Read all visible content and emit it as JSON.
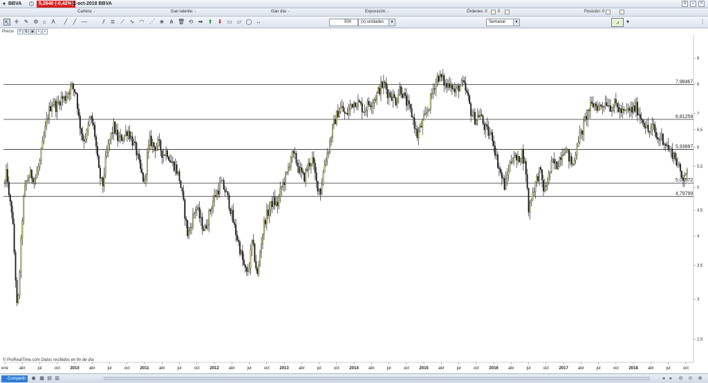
{
  "titlebar": {
    "ticker": "BBVA",
    "price_badge": "5,2640 (-0,42%)",
    "date_title": "12-oct-2018 BBVA"
  },
  "portfolio": {
    "cartera": "Cartera: -",
    "gan_latente": "Gan latente: -",
    "gan_dia": "Gan día: -",
    "exposicion": "Exposición: -",
    "ordenes": "Órdenes: 0",
    "ordenes_val": "0",
    "posicion": "Posición: 0"
  },
  "toolbar": {
    "quantity": "500",
    "units_select": "(x) unidades",
    "period_select": "Semanal"
  },
  "chart_header": {
    "label": "Precio"
  },
  "footnote": {
    "brand": "© ProRealTime.com",
    "text": "Datos recibidos en fin de día"
  },
  "statusbar": {
    "share_label": "Compartir"
  },
  "colors": {
    "candle_up": "#c8c878",
    "candle_down": "#1a1a1a",
    "line": "#2a2a2a",
    "badge": "#d82020"
  },
  "chart_data": {
    "type": "candlestick",
    "symbol": "BBVA",
    "period": "weekly",
    "scale": "log",
    "ylim": [
      2.25,
      10.0
    ],
    "y_ticks": [
      2.5,
      3,
      3.5,
      4,
      4.5,
      5,
      5.5,
      6,
      6.5,
      7,
      8,
      9
    ],
    "x_ticks": [
      {
        "label": "ene",
        "t": 2009.0
      },
      {
        "label": "abr",
        "t": 2009.25
      },
      {
        "label": "jul",
        "t": 2009.5
      },
      {
        "label": "oct",
        "t": 2009.75
      },
      {
        "label": "2010",
        "t": 2010.0
      },
      {
        "label": "abr",
        "t": 2010.25
      },
      {
        "label": "jul",
        "t": 2010.5
      },
      {
        "label": "oct",
        "t": 2010.75
      },
      {
        "label": "2011",
        "t": 2011.0
      },
      {
        "label": "abr",
        "t": 2011.25
      },
      {
        "label": "jul",
        "t": 2011.5
      },
      {
        "label": "oct",
        "t": 2011.75
      },
      {
        "label": "2012",
        "t": 2012.0
      },
      {
        "label": "abr",
        "t": 2012.25
      },
      {
        "label": "jul",
        "t": 2012.5
      },
      {
        "label": "oct",
        "t": 2012.75
      },
      {
        "label": "2013",
        "t": 2013.0
      },
      {
        "label": "abr",
        "t": 2013.25
      },
      {
        "label": "jul",
        "t": 2013.5
      },
      {
        "label": "oct",
        "t": 2013.75
      },
      {
        "label": "2014",
        "t": 2014.0
      },
      {
        "label": "abr",
        "t": 2014.25
      },
      {
        "label": "jul",
        "t": 2014.5
      },
      {
        "label": "oct",
        "t": 2014.75
      },
      {
        "label": "2015",
        "t": 2015.0
      },
      {
        "label": "abr",
        "t": 2015.25
      },
      {
        "label": "jul",
        "t": 2015.5
      },
      {
        "label": "oct",
        "t": 2015.75
      },
      {
        "label": "2016",
        "t": 2016.0
      },
      {
        "label": "abr",
        "t": 2016.25
      },
      {
        "label": "jul",
        "t": 2016.5
      },
      {
        "label": "oct",
        "t": 2016.75
      },
      {
        "label": "2017",
        "t": 2017.0
      },
      {
        "label": "abr",
        "t": 2017.25
      },
      {
        "label": "jul",
        "t": 2017.5
      },
      {
        "label": "oct",
        "t": 2017.75
      },
      {
        "label": "2018",
        "t": 2018.0
      },
      {
        "label": "abr",
        "t": 2018.25
      },
      {
        "label": "jul",
        "t": 2018.5
      },
      {
        "label": "oct",
        "t": 2018.75
      }
    ],
    "horizontal_levels": [
      {
        "value": 7.98467,
        "label": "7,98467"
      },
      {
        "value": 6.81259,
        "label": "6,81259"
      },
      {
        "value": 5.93887,
        "label": "5,93887"
      },
      {
        "value": 5.09572,
        "label": "5,09572"
      },
      {
        "value": 4.79799,
        "label": "4,79799"
      }
    ],
    "close_path": [
      [
        2009.0,
        5.1
      ],
      [
        2009.03,
        5.4
      ],
      [
        2009.06,
        4.7
      ],
      [
        2009.1,
        4.5
      ],
      [
        2009.14,
        3.6
      ],
      [
        2009.18,
        2.75
      ],
      [
        2009.22,
        3.6
      ],
      [
        2009.26,
        4.6
      ],
      [
        2009.3,
        5.1
      ],
      [
        2009.36,
        5.3
      ],
      [
        2009.44,
        5.2
      ],
      [
        2009.5,
        5.6
      ],
      [
        2009.56,
        6.3
      ],
      [
        2009.62,
        7.0
      ],
      [
        2009.68,
        7.4
      ],
      [
        2009.74,
        7.2
      ],
      [
        2009.8,
        7.5
      ],
      [
        2009.86,
        7.5
      ],
      [
        2009.92,
        7.8
      ],
      [
        2009.96,
        7.9
      ],
      [
        2010.02,
        7.7
      ],
      [
        2010.06,
        6.8
      ],
      [
        2010.12,
        6.2
      ],
      [
        2010.18,
        6.4
      ],
      [
        2010.22,
        6.9
      ],
      [
        2010.28,
        6.5
      ],
      [
        2010.34,
        5.4
      ],
      [
        2010.4,
        5.0
      ],
      [
        2010.44,
        5.6
      ],
      [
        2010.5,
        6.2
      ],
      [
        2010.56,
        6.6
      ],
      [
        2010.62,
        6.2
      ],
      [
        2010.7,
        6.3
      ],
      [
        2010.76,
        6.5
      ],
      [
        2010.82,
        6.2
      ],
      [
        2010.88,
        5.9
      ],
      [
        2010.94,
        5.4
      ],
      [
        2011.0,
        5.1
      ],
      [
        2011.04,
        5.8
      ],
      [
        2011.08,
        6.2
      ],
      [
        2011.14,
        6.0
      ],
      [
        2011.2,
        6.1
      ],
      [
        2011.26,
        5.8
      ],
      [
        2011.32,
        5.9
      ],
      [
        2011.38,
        5.6
      ],
      [
        2011.44,
        5.5
      ],
      [
        2011.5,
        5.2
      ],
      [
        2011.56,
        4.6
      ],
      [
        2011.62,
        4.0
      ],
      [
        2011.68,
        4.3
      ],
      [
        2011.74,
        4.6
      ],
      [
        2011.8,
        4.3
      ],
      [
        2011.86,
        4.1
      ],
      [
        2011.92,
        4.4
      ],
      [
        2011.98,
        4.7
      ],
      [
        2012.04,
        4.9
      ],
      [
        2012.1,
        5.1
      ],
      [
        2012.16,
        4.9
      ],
      [
        2012.22,
        4.6
      ],
      [
        2012.28,
        4.2
      ],
      [
        2012.34,
        3.9
      ],
      [
        2012.38,
        3.7
      ],
      [
        2012.42,
        3.5
      ],
      [
        2012.46,
        3.35
      ],
      [
        2012.5,
        3.5
      ],
      [
        2012.54,
        3.9
      ],
      [
        2012.58,
        3.6
      ],
      [
        2012.62,
        3.3
      ],
      [
        2012.66,
        3.8
      ],
      [
        2012.72,
        4.3
      ],
      [
        2012.78,
        4.5
      ],
      [
        2012.84,
        4.7
      ],
      [
        2012.9,
        4.6
      ],
      [
        2012.96,
        5.0
      ],
      [
        2013.04,
        5.3
      ],
      [
        2013.1,
        5.8
      ],
      [
        2013.16,
        5.7
      ],
      [
        2013.22,
        5.4
      ],
      [
        2013.28,
        5.2
      ],
      [
        2013.34,
        5.5
      ],
      [
        2013.4,
        5.7
      ],
      [
        2013.46,
        5.1
      ],
      [
        2013.52,
        4.9
      ],
      [
        2013.58,
        5.6
      ],
      [
        2013.64,
        6.0
      ],
      [
        2013.7,
        6.6
      ],
      [
        2013.76,
        7.0
      ],
      [
        2013.82,
        7.2
      ],
      [
        2013.88,
        6.9
      ],
      [
        2013.96,
        7.3
      ],
      [
        2014.02,
        7.4
      ],
      [
        2014.08,
        7.3
      ],
      [
        2014.14,
        7.1
      ],
      [
        2014.2,
        7.3
      ],
      [
        2014.26,
        7.4
      ],
      [
        2014.32,
        7.6
      ],
      [
        2014.38,
        7.9
      ],
      [
        2014.44,
        8.0
      ],
      [
        2014.48,
        7.7
      ],
      [
        2014.54,
        7.6
      ],
      [
        2014.6,
        7.4
      ],
      [
        2014.66,
        7.9
      ],
      [
        2014.72,
        7.5
      ],
      [
        2014.78,
        7.2
      ],
      [
        2014.84,
        6.9
      ],
      [
        2014.9,
        6.3
      ],
      [
        2014.96,
        6.6
      ],
      [
        2015.02,
        6.9
      ],
      [
        2015.08,
        7.3
      ],
      [
        2015.14,
        7.9
      ],
      [
        2015.2,
        8.3
      ],
      [
        2015.26,
        8.2
      ],
      [
        2015.32,
        7.9
      ],
      [
        2015.38,
        8.1
      ],
      [
        2015.44,
        7.7
      ],
      [
        2015.5,
        7.9
      ],
      [
        2015.56,
        8.0
      ],
      [
        2015.62,
        7.6
      ],
      [
        2015.68,
        7.0
      ],
      [
        2015.74,
        6.8
      ],
      [
        2015.8,
        7.0
      ],
      [
        2015.86,
        6.6
      ],
      [
        2015.92,
        6.4
      ],
      [
        2015.98,
        6.3
      ],
      [
        2016.04,
        5.7
      ],
      [
        2016.1,
        5.3
      ],
      [
        2016.16,
        5.0
      ],
      [
        2016.22,
        5.5
      ],
      [
        2016.28,
        5.8
      ],
      [
        2016.34,
        5.6
      ],
      [
        2016.4,
        5.9
      ],
      [
        2016.46,
        5.4
      ],
      [
        2016.5,
        4.5
      ],
      [
        2016.54,
        4.8
      ],
      [
        2016.6,
        5.1
      ],
      [
        2016.66,
        5.4
      ],
      [
        2016.72,
        4.9
      ],
      [
        2016.78,
        5.2
      ],
      [
        2016.84,
        5.6
      ],
      [
        2016.9,
        5.5
      ],
      [
        2016.96,
        5.8
      ],
      [
        2017.02,
        6.0
      ],
      [
        2017.08,
        5.7
      ],
      [
        2017.14,
        5.5
      ],
      [
        2017.2,
        6.2
      ],
      [
        2017.26,
        6.4
      ],
      [
        2017.32,
        6.9
      ],
      [
        2017.38,
        7.2
      ],
      [
        2017.44,
        7.3
      ],
      [
        2017.5,
        7.2
      ],
      [
        2017.56,
        7.3
      ],
      [
        2017.62,
        7.4
      ],
      [
        2017.68,
        7.2
      ],
      [
        2017.74,
        7.3
      ],
      [
        2017.8,
        7.1
      ],
      [
        2017.86,
        7.0
      ],
      [
        2017.92,
        7.1
      ],
      [
        2017.98,
        7.1
      ],
      [
        2018.04,
        7.2
      ],
      [
        2018.1,
        6.9
      ],
      [
        2018.16,
        6.7
      ],
      [
        2018.22,
        6.4
      ],
      [
        2018.28,
        6.6
      ],
      [
        2018.34,
        6.2
      ],
      [
        2018.4,
        6.3
      ],
      [
        2018.46,
        6.1
      ],
      [
        2018.52,
        5.9
      ],
      [
        2018.58,
        5.8
      ],
      [
        2018.64,
        5.5
      ],
      [
        2018.7,
        5.2
      ],
      [
        2018.74,
        5.4
      ],
      [
        2018.78,
        5.26
      ]
    ]
  }
}
